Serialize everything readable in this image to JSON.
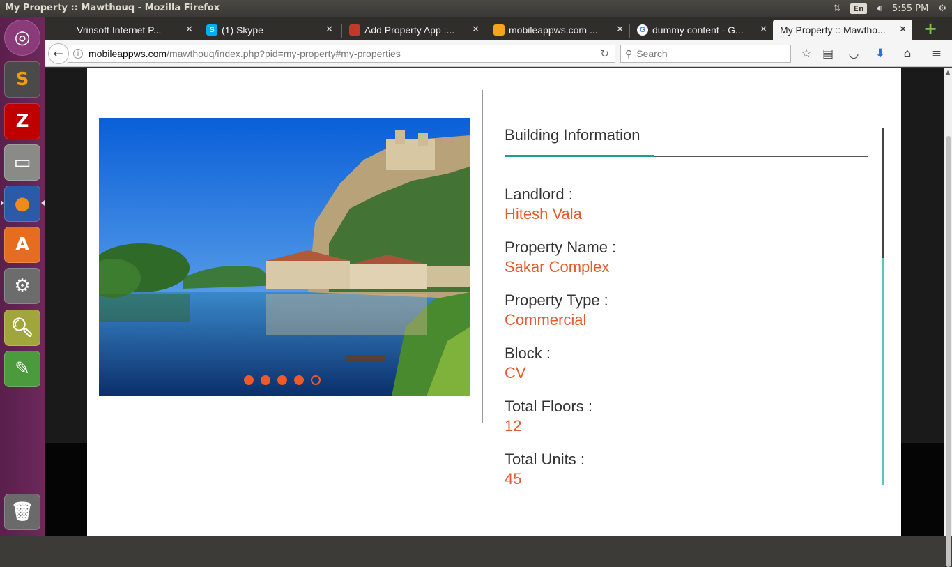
{
  "window": {
    "title": "My Property :: Mawthouq - Mozilla Firefox"
  },
  "system_tray": {
    "language": "En",
    "clock": "5:55 PM"
  },
  "launcher": {
    "items": [
      {
        "name": "Ubuntu Dash",
        "icon": "ubuntu-logo-icon",
        "color": "#8b3b79"
      },
      {
        "name": "Sublime Text",
        "icon": "sublime-text-icon",
        "color": "#4a4a4a"
      },
      {
        "name": "FileZilla",
        "icon": "filezilla-icon",
        "color": "#bf0000"
      },
      {
        "name": "Files",
        "icon": "files-icon",
        "color": "#7a7a78"
      },
      {
        "name": "Firefox",
        "icon": "firefox-icon",
        "color": "#e0661d"
      },
      {
        "name": "Ubuntu Software",
        "icon": "software-center-icon",
        "color": "#e66d1f"
      },
      {
        "name": "System Settings",
        "icon": "settings-icon",
        "color": "#6c6c6c"
      },
      {
        "name": "Image Viewer",
        "icon": "image-viewer-icon",
        "color": "#a0a63c"
      },
      {
        "name": "Text Editor",
        "icon": "text-editor-icon",
        "color": "#4b9b3c"
      },
      {
        "name": "Trash",
        "icon": "trash-icon",
        "color": "#6a6a6a"
      }
    ]
  },
  "tabs": [
    {
      "label": "Vrinsoft Internet P...",
      "favicon_color": "#2f2e2b",
      "active": false
    },
    {
      "label": "(1) Skype",
      "favicon_color": "#00aff0",
      "favicon_text": "S",
      "active": false
    },
    {
      "label": "Add Property App :...",
      "favicon_color": "#c0392b",
      "active": false
    },
    {
      "label": "mobileappws.com ...",
      "favicon_color": "#f7a41d",
      "active": false
    },
    {
      "label": "dummy content - G...",
      "favicon_color": "#4285f4",
      "favicon_text": "G",
      "active": false
    },
    {
      "label": "My Property :: Mawtho...",
      "favicon_color": "#f5f5f5",
      "active": true
    }
  ],
  "navbar": {
    "url_host": "mobileappws.com",
    "url_path": "/mawthouq/index.php?pid=my-property#my-properties",
    "search_placeholder": "Search"
  },
  "building_info": {
    "heading": "Building Information",
    "fields": [
      {
        "label": "Landlord :",
        "value": "Hitesh Vala"
      },
      {
        "label": "Property Name :",
        "value": "Sakar Complex"
      },
      {
        "label": "Property Type :",
        "value": "Commercial"
      },
      {
        "label": "Block :",
        "value": "CV"
      },
      {
        "label": "Total Floors :",
        "value": "12"
      },
      {
        "label": "Total Units :",
        "value": "45"
      }
    ]
  },
  "carousel": {
    "slide_count": 5,
    "active_index": 4
  },
  "colors": {
    "accent_orange": "#e85a2b",
    "accent_teal": "#1f9e95"
  }
}
